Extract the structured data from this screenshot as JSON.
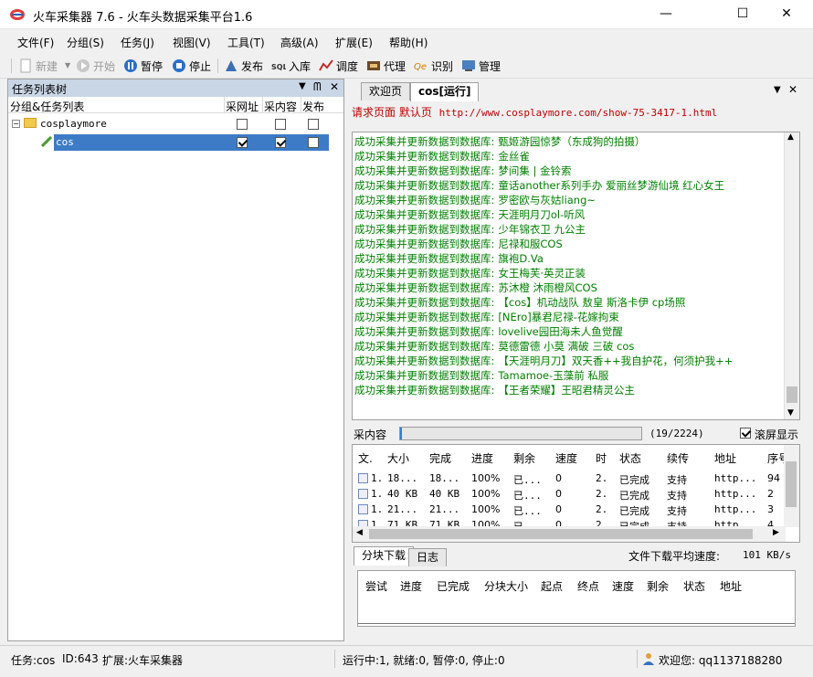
{
  "window": {
    "title": "火车采集器 7.6 - 火车头数据采集平台1.6",
    "minimize": "—",
    "maximize": "☐",
    "close": "✕"
  },
  "menu": [
    "文件(F)",
    "分组(S)",
    "任务(J)",
    "视图(V)",
    "工具(T)",
    "高级(A)",
    "扩展(E)",
    "帮助(H)"
  ],
  "toolbar": {
    "new": "新建",
    "start": "开始",
    "pause": "暂停",
    "stop": "停止",
    "publish": "发布",
    "import": "入库",
    "schedule": "调度",
    "proxy": "代理",
    "recognize": "识别",
    "manage": "管理"
  },
  "left_panel": {
    "title": "任务列表树",
    "col_group": "分组&任务列表",
    "col_url": "采网址",
    "col_content": "采内容",
    "col_publish": "发布",
    "group": {
      "name": "cosplaymore",
      "url": false,
      "content": false,
      "publish": false
    },
    "task": {
      "name": "cos",
      "url": true,
      "content": true,
      "publish": false
    }
  },
  "right_panel": {
    "tab_welcome": "欢迎页",
    "tab_task": "cos[运行]",
    "url_label": "请求页面 默认页",
    "url": "http://www.cosplaymore.com/show-75-3417-1.html",
    "log_prefix": "成功采集并更新数据到数据库:",
    "log_items": [
      "甄姬游园惊梦（东成狗的拍摄）",
      "金丝雀",
      "梦间集 | 金铃索",
      "童话another系列手办 爱丽丝梦游仙境 红心女王",
      "罗密欧与灰姑liang~",
      "天涯明月刀ol-听风",
      "少年锦衣卫 九公主",
      "尼禄和服COS",
      "旗袍D.Va",
      "女王梅芙·英灵正装",
      "苏沐橙 沐雨橙风COS",
      "【cos】机动战队 敖皇 斯洛卡伊 cp场照",
      "[NEro]暴君尼禄-花嫁拘束",
      "lovelive园田海未人鱼觉醒",
      "莫德雷德 小莫 满破 三破 cos",
      "【天涯明月刀】双天香++我自护花，何须护我++",
      "Tamamoe-玉藻前 私服",
      "【王者荣耀】王昭君精灵公主"
    ],
    "progress_label": "采内容",
    "progress_text": "(19/2224)",
    "progress_value": 0.0085,
    "scroll_display_label": "滚屏显示",
    "scroll_display_checked": true,
    "dl_headers": [
      "文.",
      "大小",
      "完成",
      "进度",
      "剩余",
      "速度",
      "时",
      "状态",
      "续传",
      "地址",
      "序号"
    ],
    "dl_rows": [
      [
        "1.",
        "18...",
        "18...",
        "100%",
        "已...",
        "0",
        "2.",
        "已完成",
        "支持",
        "http...",
        "94"
      ],
      [
        "1.",
        "40 KB",
        "40 KB",
        "100%",
        "已...",
        "0",
        "2.",
        "已完成",
        "支持",
        "http...",
        "2"
      ],
      [
        "1.",
        "21...",
        "21...",
        "100%",
        "已...",
        "0",
        "2.",
        "已完成",
        "支持",
        "http...",
        "3"
      ],
      [
        "1.",
        "71 KB",
        "71 KB",
        "100%",
        "已...",
        "0",
        "2.",
        "已完成",
        "支持",
        "http...",
        "4"
      ]
    ],
    "tab_segment": "分块下载",
    "tab_log": "日志",
    "avg_speed_label": "文件下载平均速度:",
    "avg_speed_value": "101 KB/s",
    "seg_headers": [
      "尝试",
      "进度",
      "已完成",
      "分块大小",
      "起点",
      "终点",
      "速度",
      "剩余",
      "状态",
      "地址"
    ]
  },
  "statusbar": {
    "task": "任务:cos",
    "id": "ID:643",
    "ext": "扩展:火车采集器",
    "running": "运行中:1, 就绪:0, 暂停:0, 停止:0",
    "welcome": "欢迎您: qq1137188280"
  },
  "colors": {
    "log_green": "#008000",
    "url_red": "#c00000",
    "selection": "#3d7bc6",
    "panel_header": "#c9d6e6"
  }
}
